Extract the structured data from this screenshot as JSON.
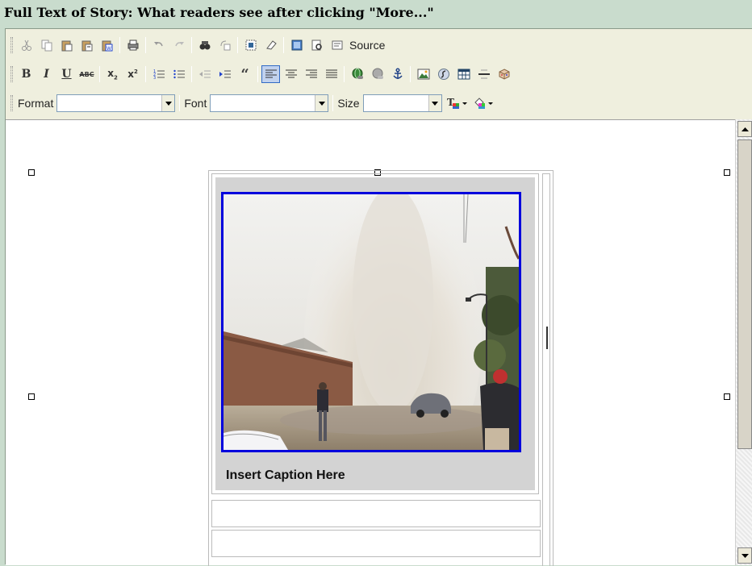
{
  "title": "Full Text of Story: What readers see after clicking \"More...\"",
  "toolbar": {
    "row1_icons": [
      "cut-icon",
      "copy-icon",
      "paste-icon",
      "paste-text-icon",
      "paste-word-icon",
      "print-icon",
      "undo-icon",
      "redo-icon",
      "find-icon",
      "replace-icon",
      "select-all-icon",
      "remove-format-icon",
      "preview-icon",
      "templates-icon",
      "source-icon"
    ],
    "source_label": "Source",
    "row2_icons": [
      "bold-icon",
      "italic-icon",
      "underline-icon",
      "strikethrough-icon",
      "subscript-icon",
      "superscript-icon",
      "numbered-list-icon",
      "bulleted-list-icon",
      "outdent-icon",
      "indent-icon",
      "blockquote-icon",
      "align-left-icon",
      "align-center-icon",
      "align-right-icon",
      "justify-icon",
      "link-icon",
      "unlink-icon",
      "anchor-icon",
      "image-icon",
      "flash-icon",
      "table-icon",
      "horizontal-rule-icon",
      "special-char-icon"
    ],
    "format_label": "Format",
    "font_label": "Font",
    "size_label": "Size",
    "format_value": "",
    "font_value": "",
    "size_value": ""
  },
  "content": {
    "caption": "Insert Caption Here"
  },
  "colors": {
    "background": "#c9dccd",
    "toolbar": "#efefde",
    "image_border": "#0000dd",
    "caption_cell": "#d3d3d3"
  }
}
